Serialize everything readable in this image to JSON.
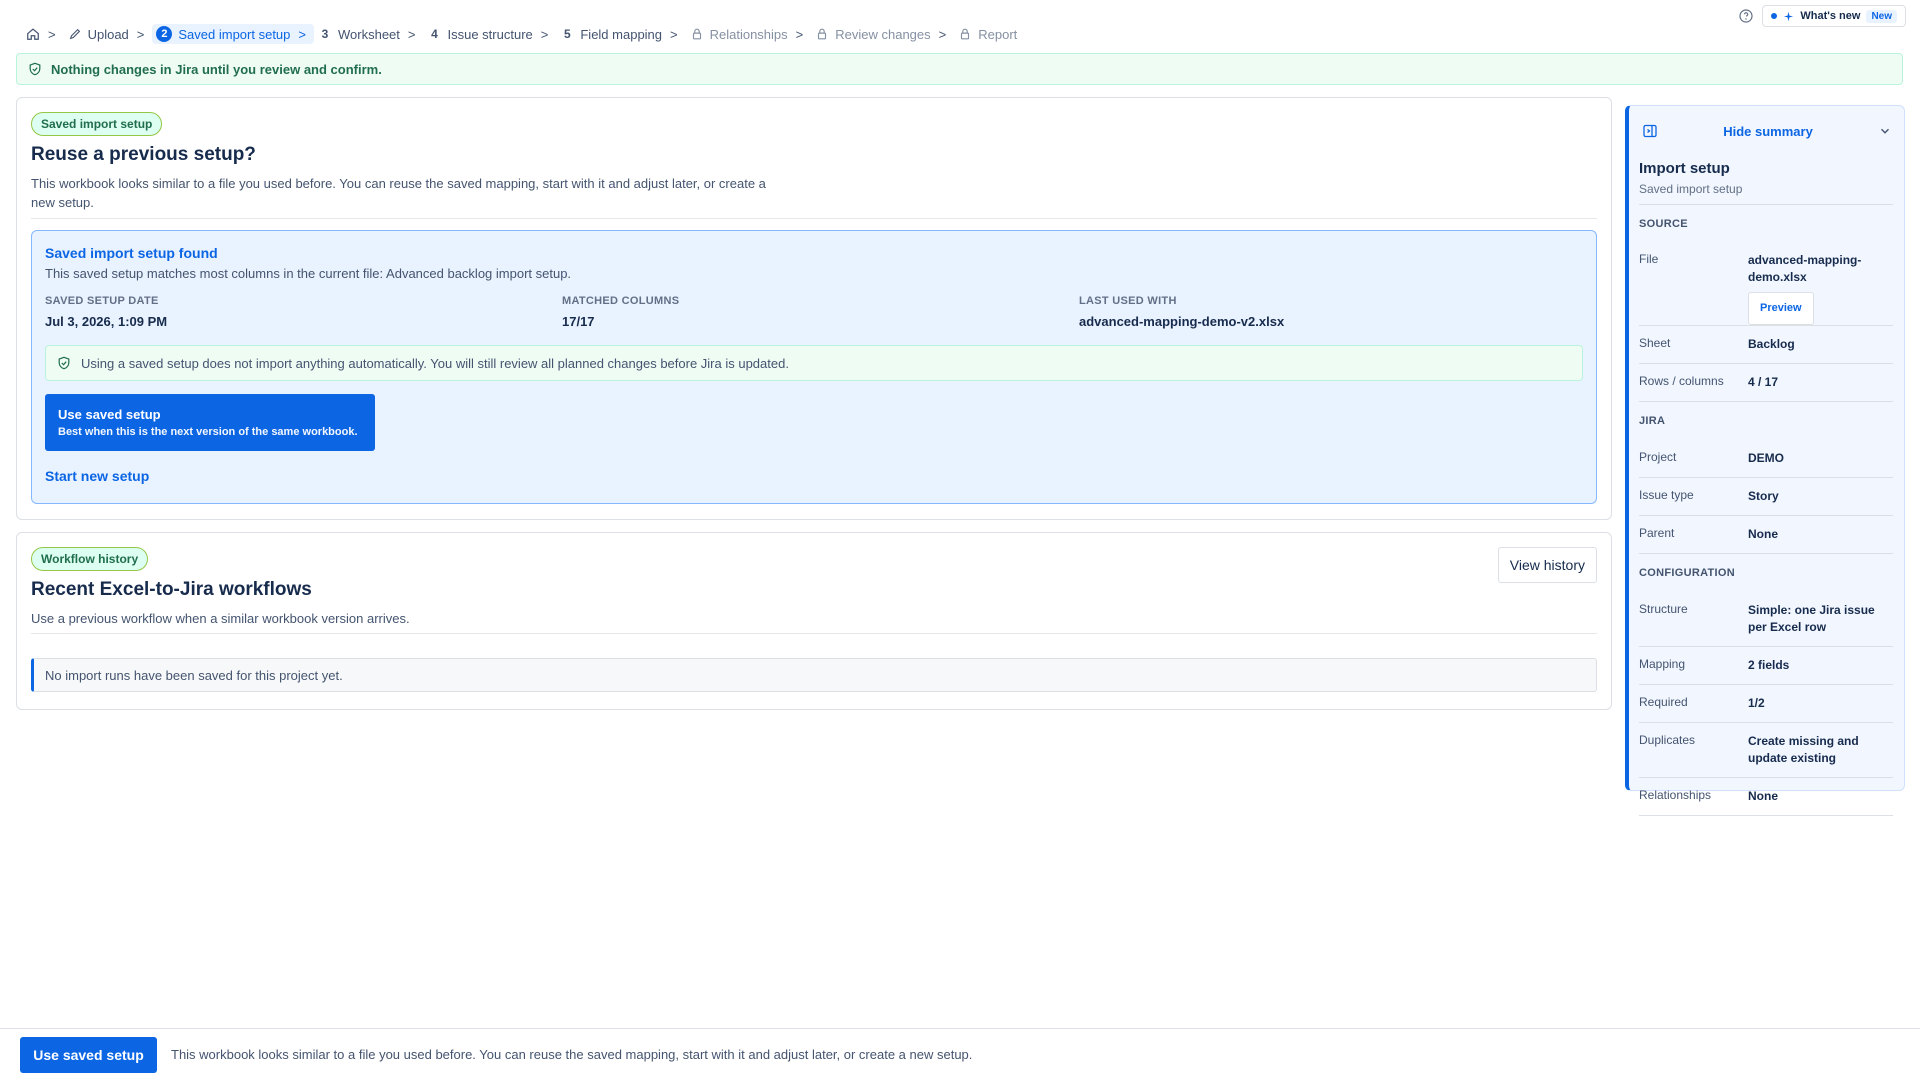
{
  "breadcrumb": {
    "steps": [
      {
        "label": "Upload",
        "num": "",
        "icon": "edit-icon"
      },
      {
        "label": "Saved import setup",
        "num": "2"
      },
      {
        "label": "Worksheet",
        "num": "3"
      },
      {
        "label": "Issue structure",
        "num": "4"
      },
      {
        "label": "Field mapping",
        "num": "5"
      },
      {
        "label": "Relationships",
        "num": "",
        "icon": "lock-icon"
      },
      {
        "label": "Review changes",
        "num": "",
        "icon": "lock-icon"
      },
      {
        "label": "Report",
        "num": "",
        "icon": "lock-icon"
      }
    ],
    "separator": ">"
  },
  "topright": {
    "whatsnew": "What's new",
    "new_badge": "New"
  },
  "banner": {
    "text": "Nothing changes in Jira until you review and confirm."
  },
  "reuse": {
    "lozenge": "Saved import setup",
    "title": "Reuse a previous setup?",
    "desc": "This workbook looks similar to a file you used before. You can reuse the saved mapping, start with it and adjust later, or create a new setup.",
    "found_title": "Saved import setup found",
    "found_desc": "This saved setup matches most columns in the current file: Advanced backlog import setup.",
    "meta": [
      {
        "k": "SAVED SETUP DATE",
        "v": "Jul 3, 2026, 1:09 PM"
      },
      {
        "k": "MATCHED COLUMNS",
        "v": "17/17"
      },
      {
        "k": "LAST USED WITH",
        "v": "advanced-mapping-demo-v2.xlsx"
      }
    ],
    "note": "Using a saved setup does not import anything automatically. You will still review all planned changes before Jira is updated.",
    "use_btn_title": "Use saved setup",
    "use_btn_sub": "Best when this is the next version of the same workbook.",
    "new_link": "Start new setup"
  },
  "history": {
    "lozenge": "Workflow history",
    "title": "Recent Excel-to-Jira workflows",
    "desc": "Use a previous workflow when a similar workbook version arrives.",
    "view_btn": "View history",
    "empty": "No import runs have been saved for this project yet."
  },
  "summary": {
    "hide_label": "Hide summary",
    "title": "Import setup",
    "subtitle": "Saved import setup",
    "source_label": "SOURCE",
    "file_k": "File",
    "file_v": "advanced-mapping-demo.xlsx",
    "preview": "Preview",
    "sheet_k": "Sheet",
    "sheet_v": "Backlog",
    "rc_k": "Rows / columns",
    "rc_v": "4 / 17",
    "jira_label": "JIRA",
    "project_k": "Project",
    "project_v": "DEMO",
    "issuetype_k": "Issue type",
    "issuetype_v": "Story",
    "parent_k": "Parent",
    "parent_v": "None",
    "config_label": "CONFIGURATION",
    "structure_k": "Structure",
    "structure_v": "Simple: one Jira issue per Excel row",
    "mapping_k": "Mapping",
    "mapping_v": "2 fields",
    "required_k": "Required",
    "required_v": "1/2",
    "dup_k": "Duplicates",
    "dup_v": "Create missing and update existing",
    "rel_k": "Relationships",
    "rel_v": "None"
  },
  "footer": {
    "button": "Use saved setup",
    "text": "This workbook looks similar to a file you used before. You can reuse the saved mapping, start with it and adjust later, or create a new setup."
  },
  "colors": {
    "accent": "#0c66e4",
    "success": "#216e4e"
  }
}
